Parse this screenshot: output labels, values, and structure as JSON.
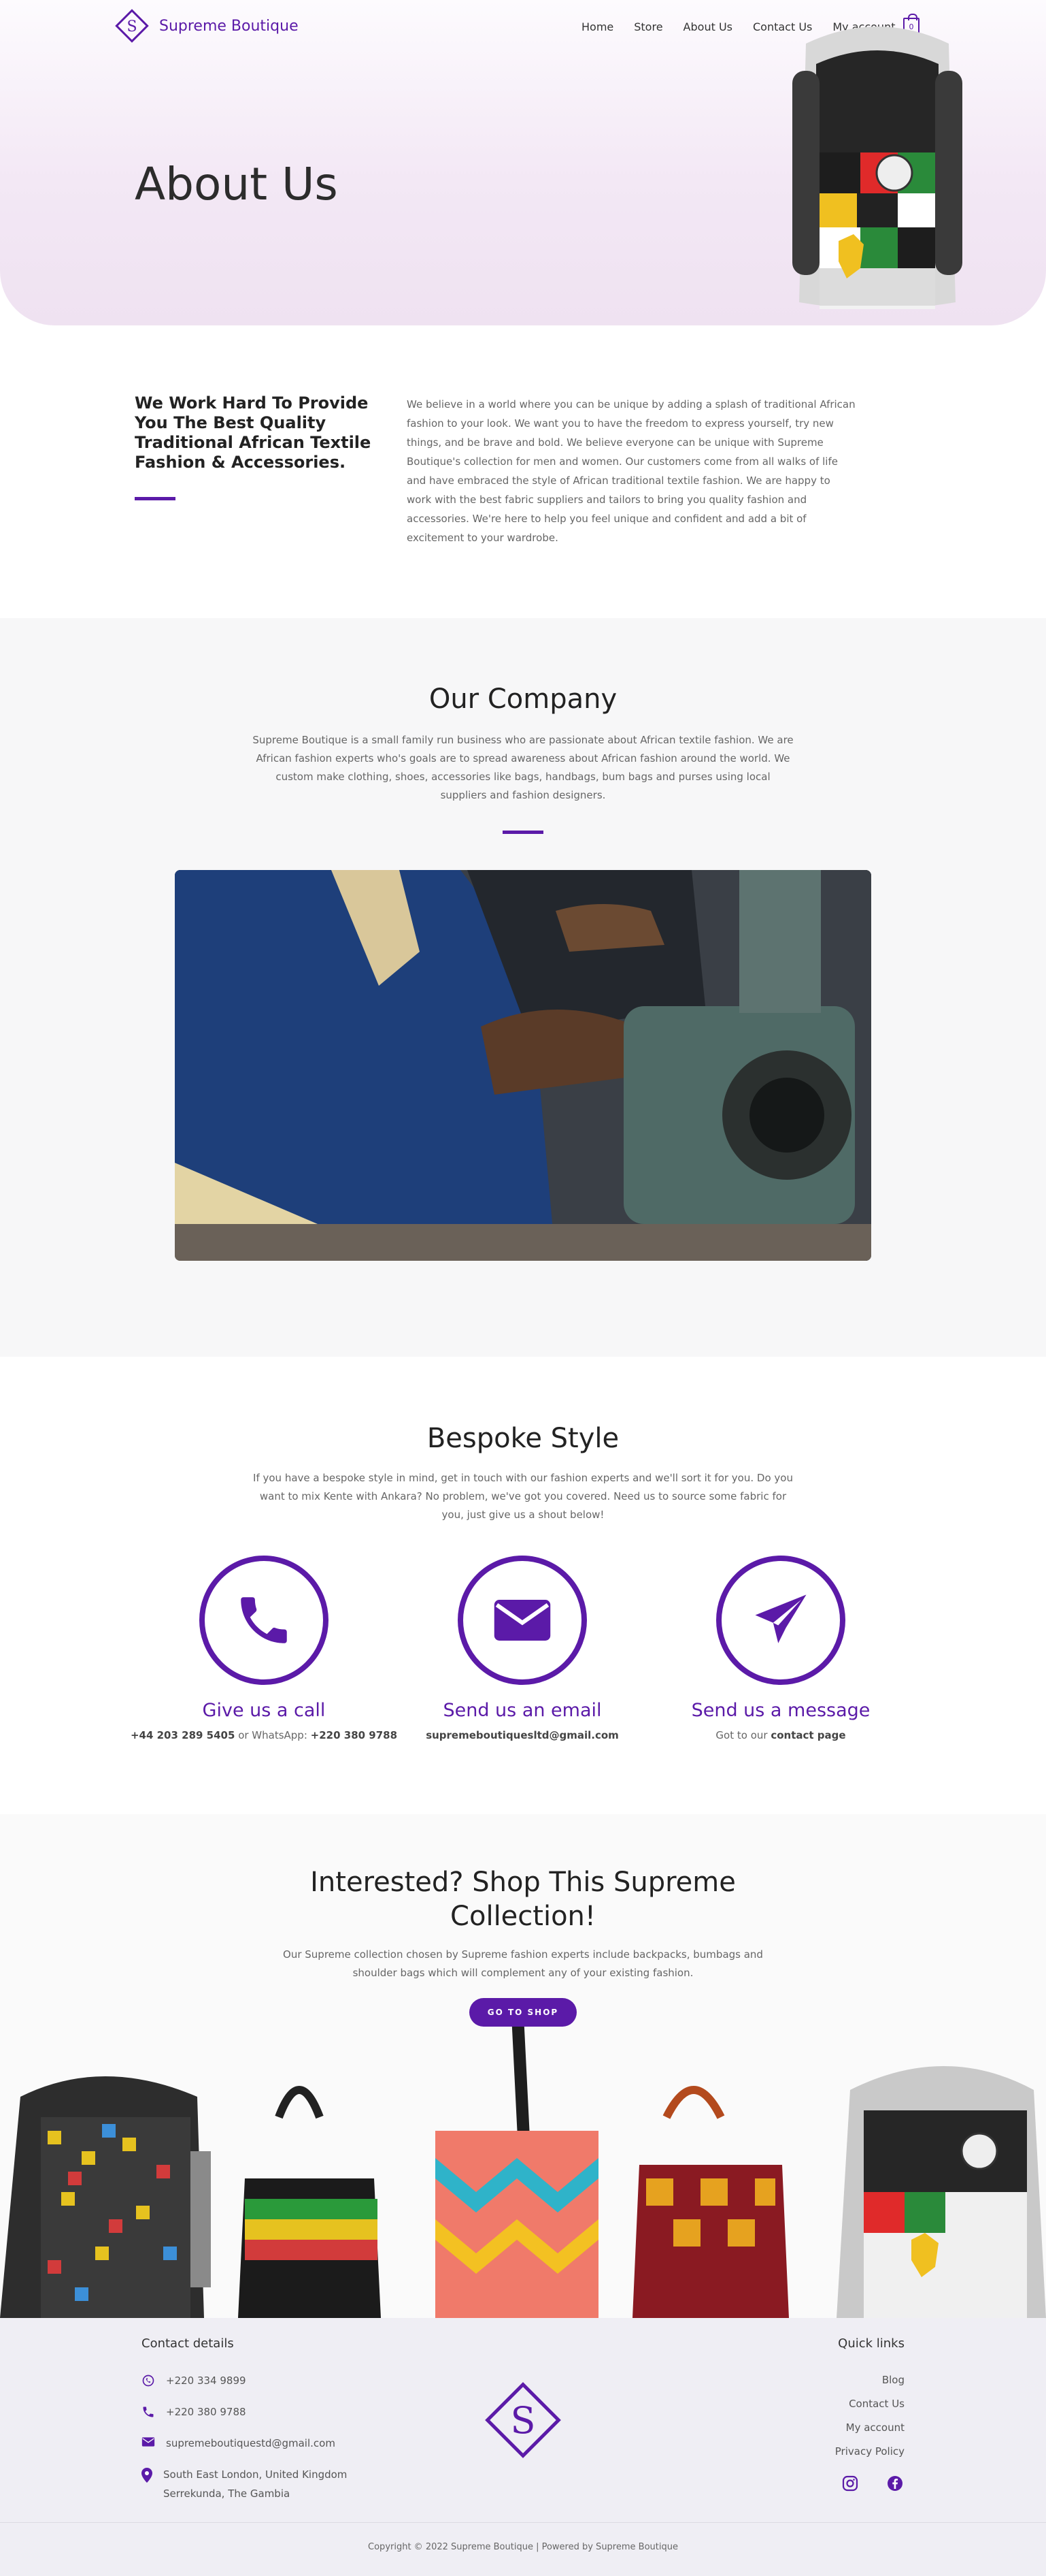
{
  "header": {
    "logo_text": "Supreme Boutique",
    "nav": [
      "Home",
      "Store",
      "About Us",
      "Contact Us",
      "My account"
    ],
    "cart_count": "0"
  },
  "hero": {
    "title": "About Us"
  },
  "intro": {
    "heading": "We Work Hard To Provide You The Best Quality Traditional African Textile Fashion & Accessories.",
    "text": "We believe in a world where you can be unique by adding a splash of traditional African fashion to your look. We want you to have the freedom to express yourself, try new things, and be brave and bold. We believe everyone can be unique with Supreme Boutique's collection for men and women. Our customers come from all walks of life and have embraced the style of African traditional textile fashion. We are happy to work with the best fabric suppliers and tailors to bring you quality fashion and accessories. We're here to help you feel unique and confident and add a bit of excitement to your wardrobe."
  },
  "company": {
    "title": "Our Company",
    "text": "Supreme Boutique is a small family run business who are passionate about African textile fashion. We are African fashion experts who's goals are to spread awareness about African fashion around the world. We custom make clothing, shoes, accessories like bags, handbags, bum bags and purses using local suppliers and fashion designers."
  },
  "bespoke": {
    "title": "Bespoke Style",
    "text": "If you have a bespoke style in mind, get in touch with our fashion experts and we'll sort it for you. Do you want to mix Kente with Ankara? No problem, we've got you covered. Need us to source some fabric for you, just give us a shout below!",
    "cards": [
      {
        "title": "Give us a call",
        "phone": "+44 203 289 5405",
        "mid": " or WhatsApp: ",
        "whatsapp": "+220 380 9788"
      },
      {
        "title": "Send us an email",
        "email": "supremeboutiquesltd@gmail.com"
      },
      {
        "title": "Send us a message",
        "pre": "Got to our ",
        "link": "contact page"
      }
    ]
  },
  "shop": {
    "title_line1": "Interested? Shop This Supreme",
    "title_line2": "Collection!",
    "text": "Our Supreme collection chosen by Supreme fashion experts include backpacks, bumbags and shoulder bags which will complement any of your existing fashion.",
    "button": "GO TO SHOP"
  },
  "footer": {
    "contact_heading": "Contact details",
    "phone1": "+220 334 9899",
    "phone2": "+220 380 9788",
    "email": "supremeboutiquestd@gmail.com",
    "address1": "South East London, United Kingdom",
    "address2": "Serrekunda, The Gambia",
    "quick_heading": "Quick links",
    "links": [
      "Blog",
      "Contact Us",
      "My account",
      "Privacy Policy"
    ],
    "copyright": "Copyright © 2022 Supreme Boutique | Powered by Supreme Boutique"
  },
  "colors": {
    "accent": "#5b1aa8",
    "hero_bg": "#f3e8f5",
    "section_bg": "#f7f7f8",
    "footer_bg": "#efeef4"
  }
}
